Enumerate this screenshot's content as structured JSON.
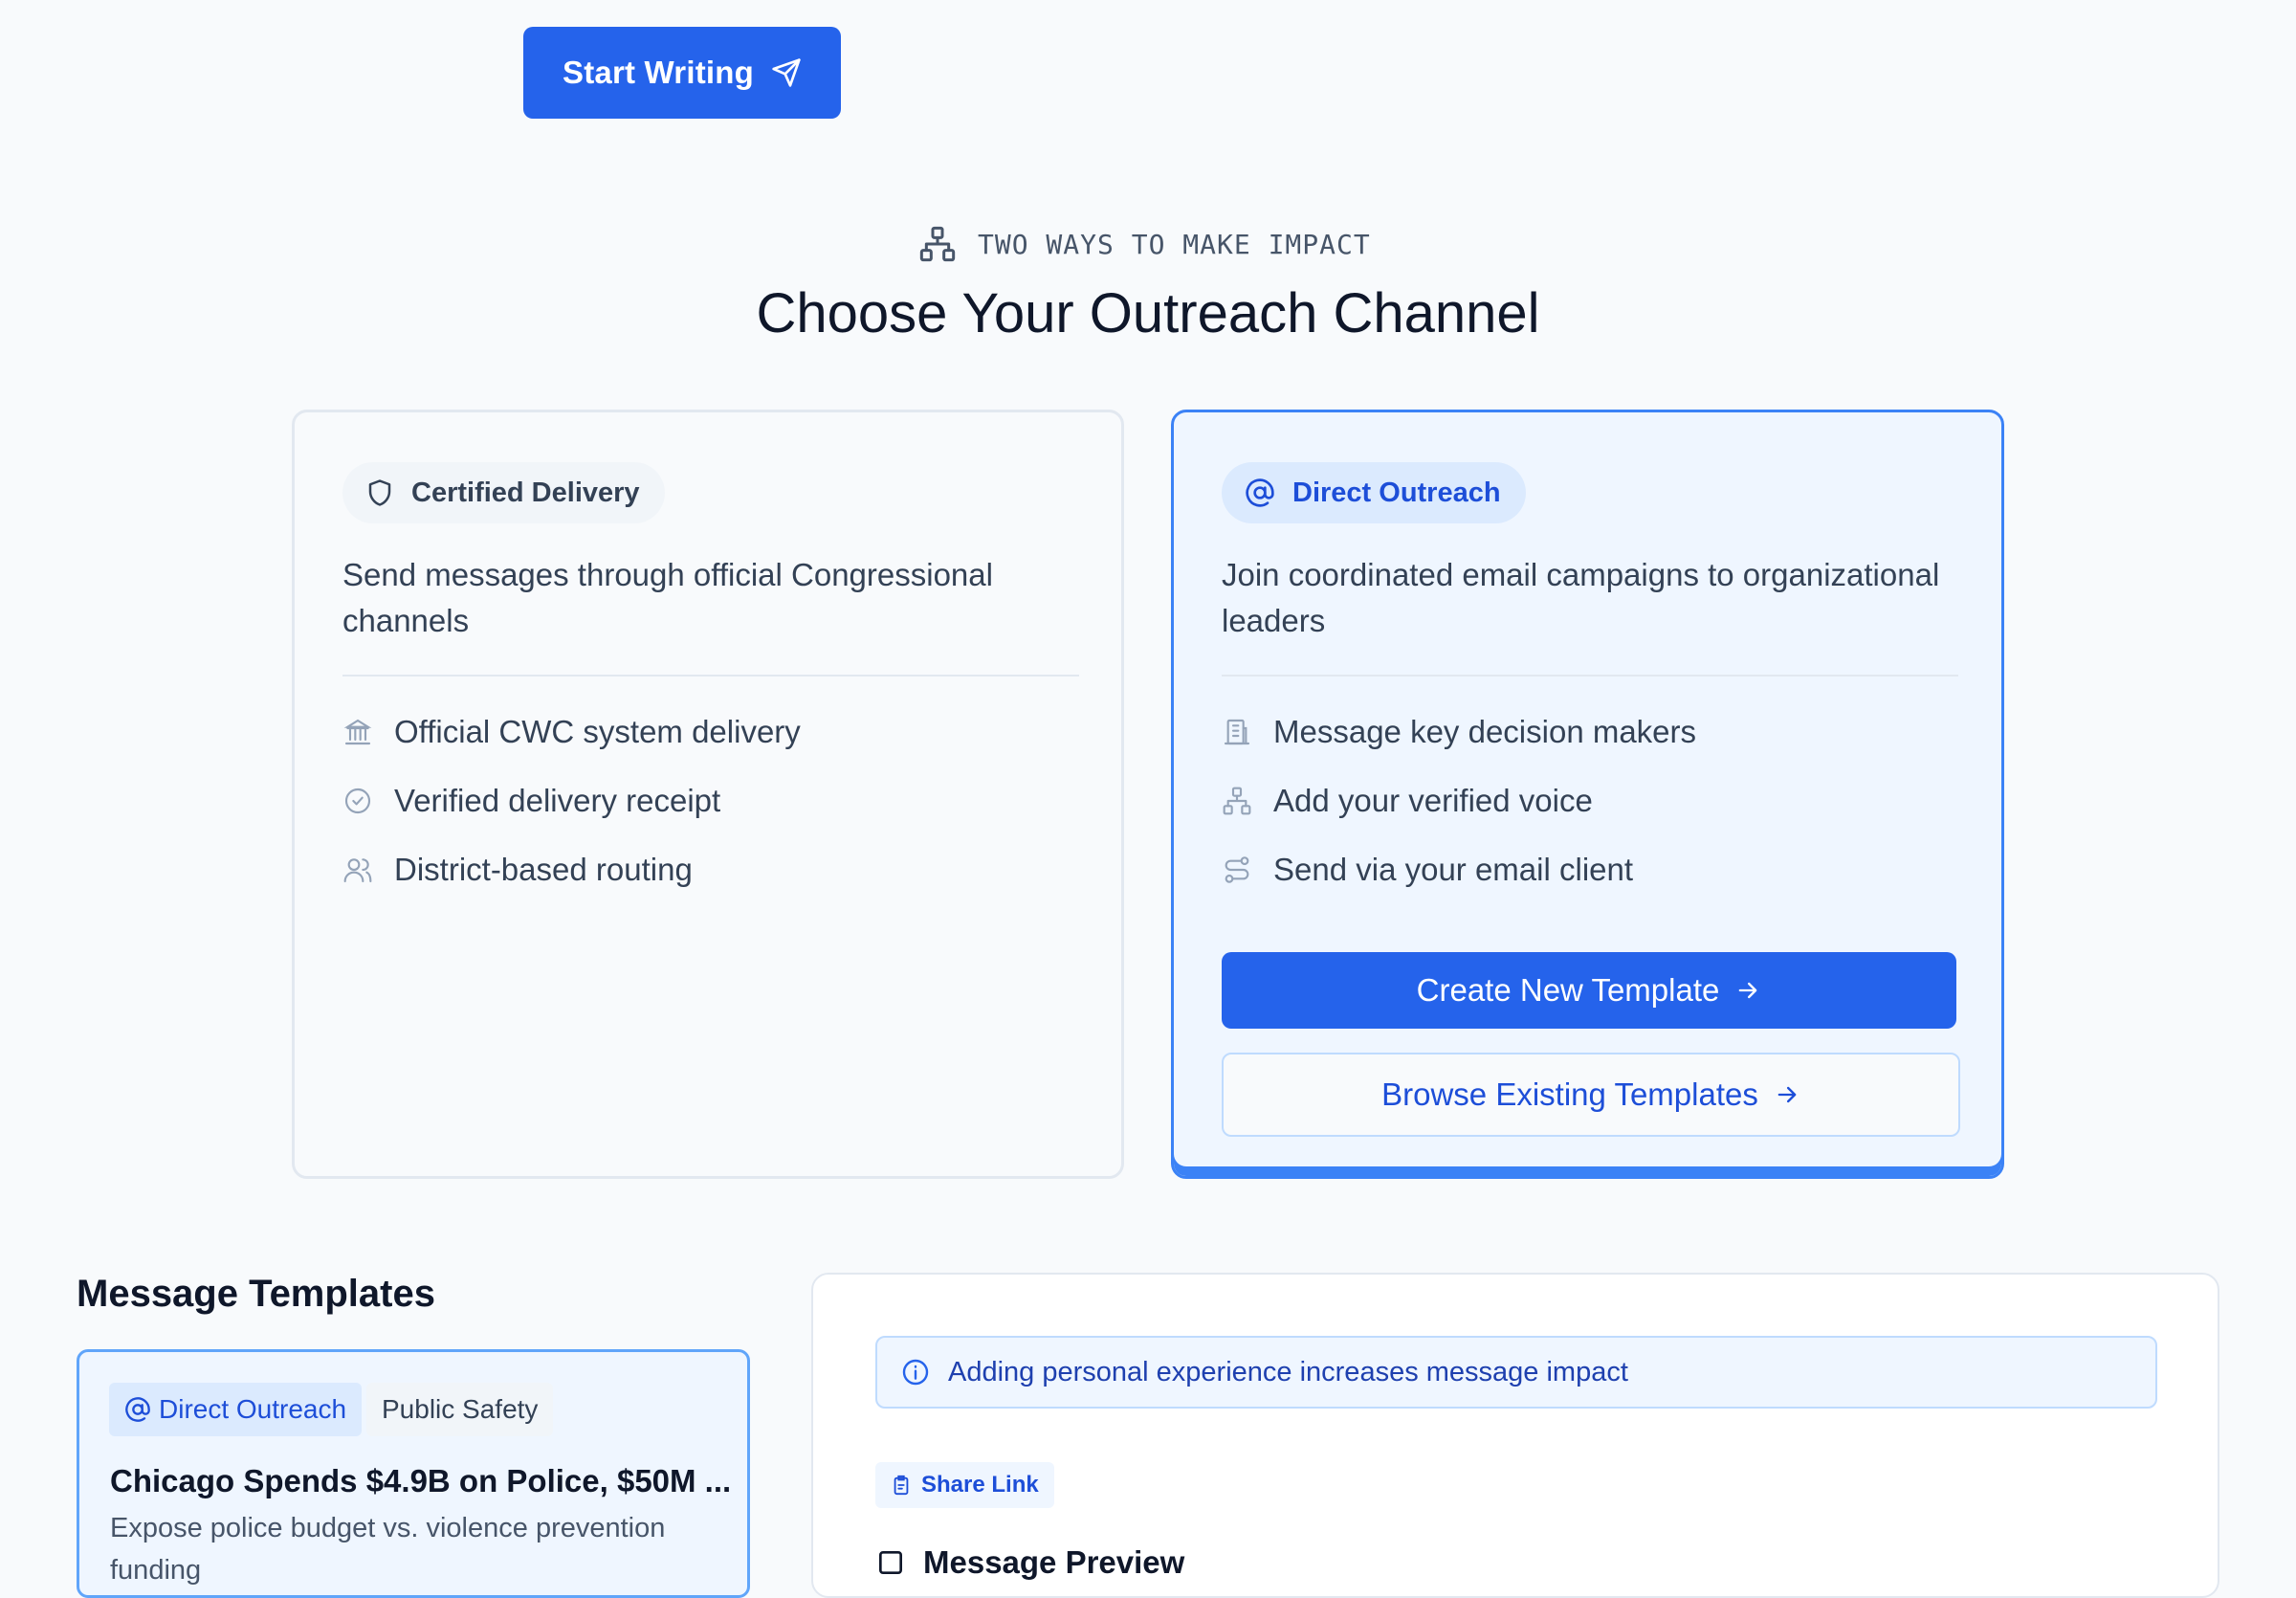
{
  "top": {
    "start_button": "Start Writing"
  },
  "section": {
    "eyebrow": "TWO WAYS TO MAKE IMPACT",
    "heading": "Choose Your Outreach Channel"
  },
  "cards": {
    "certified": {
      "badge": "Certified Delivery",
      "description": "Send messages through official Congressional channels",
      "features": [
        "Official CWC system delivery",
        "Verified delivery receipt",
        "District-based routing"
      ],
      "feature_icons": [
        "landmark-icon",
        "check-circle-icon",
        "users-icon"
      ]
    },
    "direct": {
      "badge": "Direct Outreach",
      "description": "Join coordinated email campaigns to organizational leaders",
      "features": [
        "Message key decision makers",
        "Add your verified voice",
        "Send via your email client"
      ],
      "feature_icons": [
        "building-icon",
        "network-icon",
        "route-icon"
      ],
      "create_button": "Create New Template",
      "browse_button": "Browse Existing Templates"
    }
  },
  "templates": {
    "title": "Message Templates",
    "items": [
      {
        "type_tag": "Direct Outreach",
        "category_tag": "Public Safety",
        "title": "Chicago Spends $4.9B on Police, $50M ...",
        "description": "Expose police budget vs. violence prevention funding"
      }
    ]
  },
  "editor": {
    "tip": "Adding personal experience increases message impact",
    "share_button": "Share Link",
    "partial_heading": "Message Preview"
  },
  "colors": {
    "primary": "#2563eb",
    "accent_border": "#3b82f6",
    "light_blue": "#eff6ff",
    "background": "#f8fafc"
  }
}
